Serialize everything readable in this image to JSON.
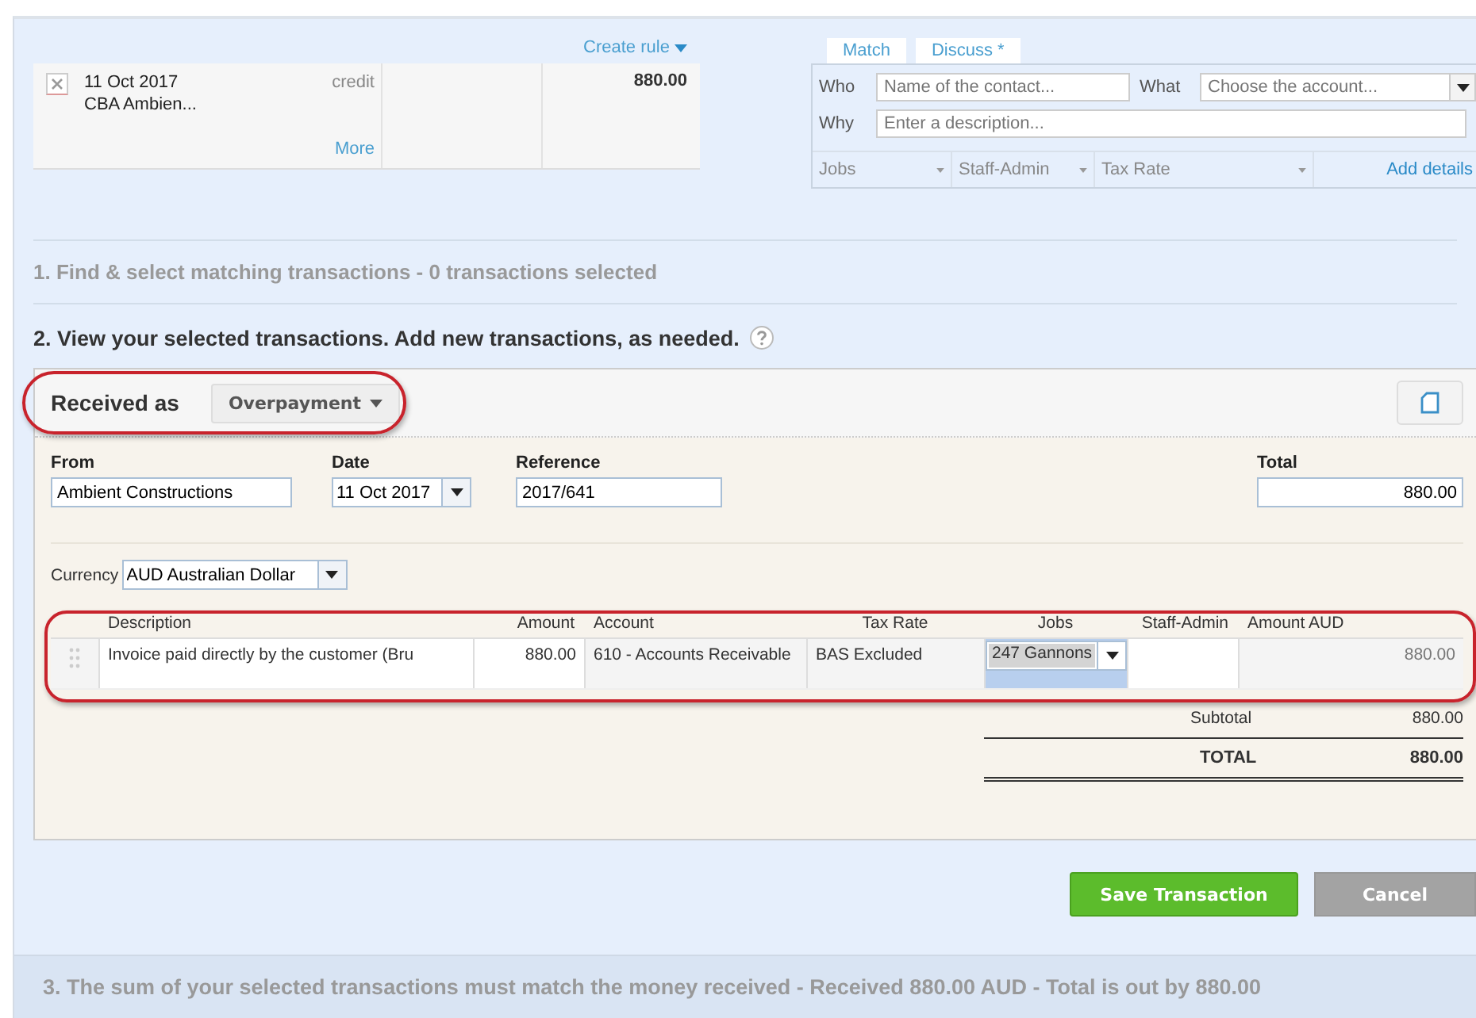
{
  "statement": {
    "create_rule": "Create rule",
    "date": "11 Oct 2017",
    "payee": "CBA Ambien...",
    "type": "credit",
    "more": "More",
    "amount": "880.00"
  },
  "reconcile_tabs": [
    {
      "label": "Match",
      "selected": false
    },
    {
      "label": "Discuss *",
      "selected": false
    }
  ],
  "quick_form": {
    "who_label": "Who",
    "who_placeholder": "Name of the contact...",
    "what_label": "What",
    "what_placeholder": "Choose the account...",
    "why_label": "Why",
    "why_placeholder": "Enter a description...",
    "tracking": [
      "Jobs",
      "Staff-Admin",
      "Tax Rate"
    ],
    "add_details": "Add details"
  },
  "step_1": "1. Find & select matching transactions - 0 transactions selected",
  "step_2": "2. View your selected transactions. Add new transactions, as needed.",
  "received_as": {
    "label": "Received as",
    "value": "Overpayment"
  },
  "fields": {
    "from_label": "From",
    "from": "Ambient Constructions",
    "date_label": "Date",
    "date": "11 Oct 2017",
    "reference_label": "Reference",
    "reference": "2017/641",
    "total_label": "Total",
    "total": "880.00",
    "currency_label": "Currency",
    "currency": "AUD Australian Dollar"
  },
  "line_items": {
    "columns": [
      "Description",
      "Amount",
      "Account",
      "Tax Rate",
      "Jobs",
      "Staff-Admin",
      "Amount AUD"
    ],
    "rows": [
      {
        "description": "Invoice paid directly by the customer (Bru",
        "amount": "880.00",
        "account": "610 - Accounts Receivable",
        "tax_rate": "BAS Excluded",
        "jobs": "247 Gannons",
        "staff_admin": "",
        "amount_aud": "880.00"
      }
    ]
  },
  "subtotal_label": "Subtotal",
  "subtotal": "880.00",
  "total_label": "TOTAL",
  "total": "880.00",
  "buttons": {
    "save": "Save Transaction",
    "cancel": "Cancel"
  },
  "step_3": "3. The sum of your selected transactions must match the money received - Received 880.00 AUD - Total is out by 880.00"
}
